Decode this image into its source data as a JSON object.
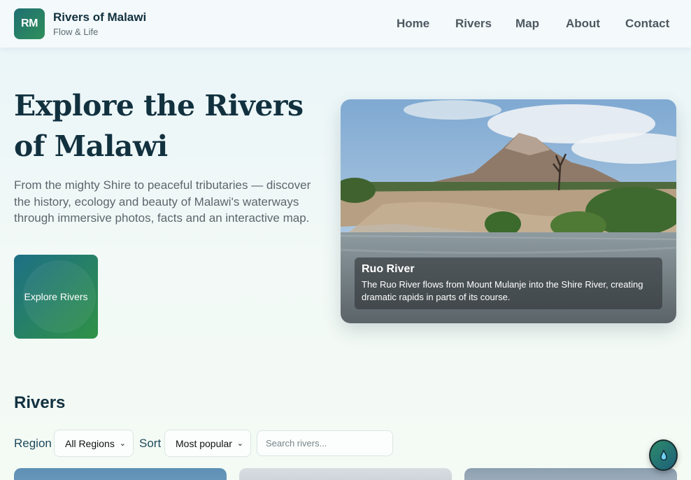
{
  "header": {
    "logo_initials": "RM",
    "title": "Rivers of Malawi",
    "subtitle": "Flow & Life",
    "nav": [
      "Home",
      "Rivers",
      "Map",
      "About",
      "Contact"
    ]
  },
  "hero": {
    "title": "Explore the Rivers of Malawi",
    "description": "From the mighty Shire to peaceful tributaries — discover the history, ecology and beauty of Malawi's waterways through immersive photos, facts and an interactive map.",
    "cta_label": "Explore Rivers",
    "featured": {
      "title": "Ruo River",
      "text": "The Ruo River flows from Mount Mulanje into the Shire River, creating dramatic rapids in parts of its course."
    }
  },
  "rivers_section": {
    "title": "Rivers",
    "region_label": "Region",
    "region_value": "All Regions",
    "sort_label": "Sort",
    "sort_value": "Most popular",
    "search_placeholder": "Search rivers..."
  },
  "colors": {
    "accent_start": "#1f6f73",
    "accent_end": "#2f8f5a",
    "heading": "#12313f"
  },
  "icons": {
    "fab": "water-drop-icon",
    "select_chevron": "chevron-down-icon"
  }
}
